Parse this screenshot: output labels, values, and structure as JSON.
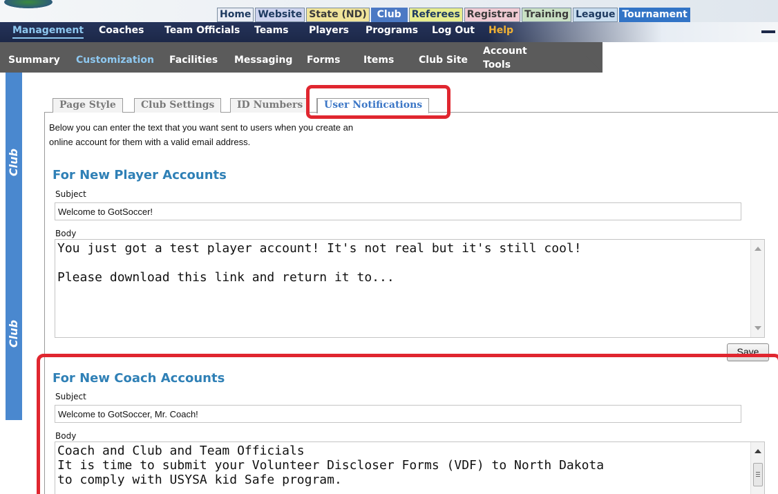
{
  "header": {
    "top_tabs": [
      "Home",
      "Website",
      "State (ND)",
      "Club",
      "Referees",
      "Registrar",
      "Training",
      "League",
      "Tournament"
    ]
  },
  "nav_primary": {
    "items": [
      "Management",
      "Coaches",
      "Team Officials",
      "Teams",
      "Players",
      "Programs",
      "Log Out",
      "Help"
    ],
    "active": "Management"
  },
  "nav_secondary": {
    "items": [
      "Summary",
      "Customization",
      "Facilities",
      "Messaging",
      "Forms",
      "Items",
      "Club Site",
      "Account",
      "Tools"
    ],
    "active": "Customization"
  },
  "sidebar": {
    "label_top": "Club",
    "label_bottom": "Club"
  },
  "content_tabs": {
    "items": [
      "Page Style",
      "Club Settings",
      "ID Numbers",
      "User Notifications"
    ],
    "active": "User Notifications"
  },
  "description": {
    "line1": "Below you can enter the text that you want sent to users when you create an",
    "line2": "online account for them with a valid email address."
  },
  "player_accounts": {
    "title": "For New Player Accounts",
    "subject_label": "Subject",
    "subject_value": "Welcome to GotSoccer!",
    "body_label": "Body",
    "body_value": "You just got a test player account! It's not real but it's still cool!\n\nPlease download this link and return it to...",
    "save_label": "Save"
  },
  "coach_accounts": {
    "title": "For New Coach Accounts",
    "subject_label": "Subject",
    "subject_value": "Welcome to GotSoccer, Mr. Coach!",
    "body_label": "Body",
    "body_value": "Coach and Club and Team Officials\nIt is time to submit your Volunteer Discloser Forms (VDF) to North Dakota\nto comply with USYSA kid Safe program."
  },
  "colors": {
    "nav_navy": "#1c2848",
    "subnav_gray": "#5b5b5b",
    "active_blue": "#8ec8f0",
    "help_orange": "#f2b233",
    "section_title": "#2f80b6",
    "annotation_red": "#e0262f",
    "sidebar_blue": "#4a88cf"
  }
}
